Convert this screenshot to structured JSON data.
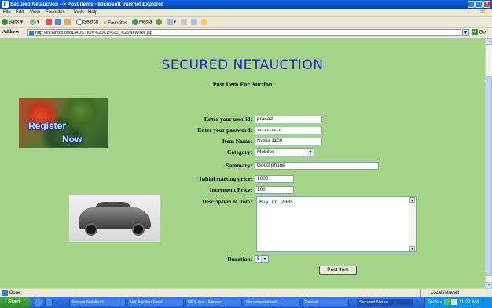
{
  "window": {
    "title": "Secured Netauction --> Post Items - Microsoft Internet Explorer",
    "controls": [
      "_",
      "□",
      "×"
    ]
  },
  "menu": [
    "File",
    "Edit",
    "View",
    "Favorites",
    "Tools",
    "Help"
  ],
  "toolbar": {
    "back": "Back",
    "search": "Search",
    "favorites": "Favorites",
    "media": "Media"
  },
  "address": {
    "label": "Address",
    "url": "http://localhost:8081/AUCTION%20CD%20_%20New/sell.jsp",
    "go": "Go"
  },
  "page": {
    "site_title": "SECURED NETAUCTION",
    "subtitle": "Post Item For Auction",
    "register_image": {
      "line1": "Register",
      "line2": "Now"
    },
    "form": {
      "user_id_label": "Enter your user id:",
      "user_id_value": "prasad",
      "password_label": "Enter your password:",
      "password_value": "●●●●●●●●●●",
      "item_name_label": "Item Name:",
      "item_name_value": "Nokia 1100",
      "category_label": "Category:",
      "category_value": "Mobiles",
      "summary_label": "Summary:",
      "summary_value": "Good phone",
      "start_price_label": "Initial starting price:",
      "start_price_value": "1000",
      "increment_label": "Increment Price:",
      "increment_value": "100",
      "description_label": "Description of item:",
      "description_value": "Buy on 2005",
      "duration_label": "Duration:",
      "duration_value": "5",
      "submit_label": "Post Item"
    }
  },
  "status": {
    "text": "Done",
    "zone": "Local intranet"
  },
  "taskbar": {
    "start": "Start",
    "tasks": [
      "Secure Net Aucti...",
      "Net Auction Final...",
      "DFS.doc - Micros...",
      "DocumentationS...",
      "Tomcat",
      "Secured Netau..."
    ],
    "tray_tools": "Tools",
    "clock": "11:22 AM"
  },
  "colors": {
    "page_bg": "#a4d487",
    "title_blue": "#2323c8",
    "xp_blue": "#0a5fd8"
  }
}
